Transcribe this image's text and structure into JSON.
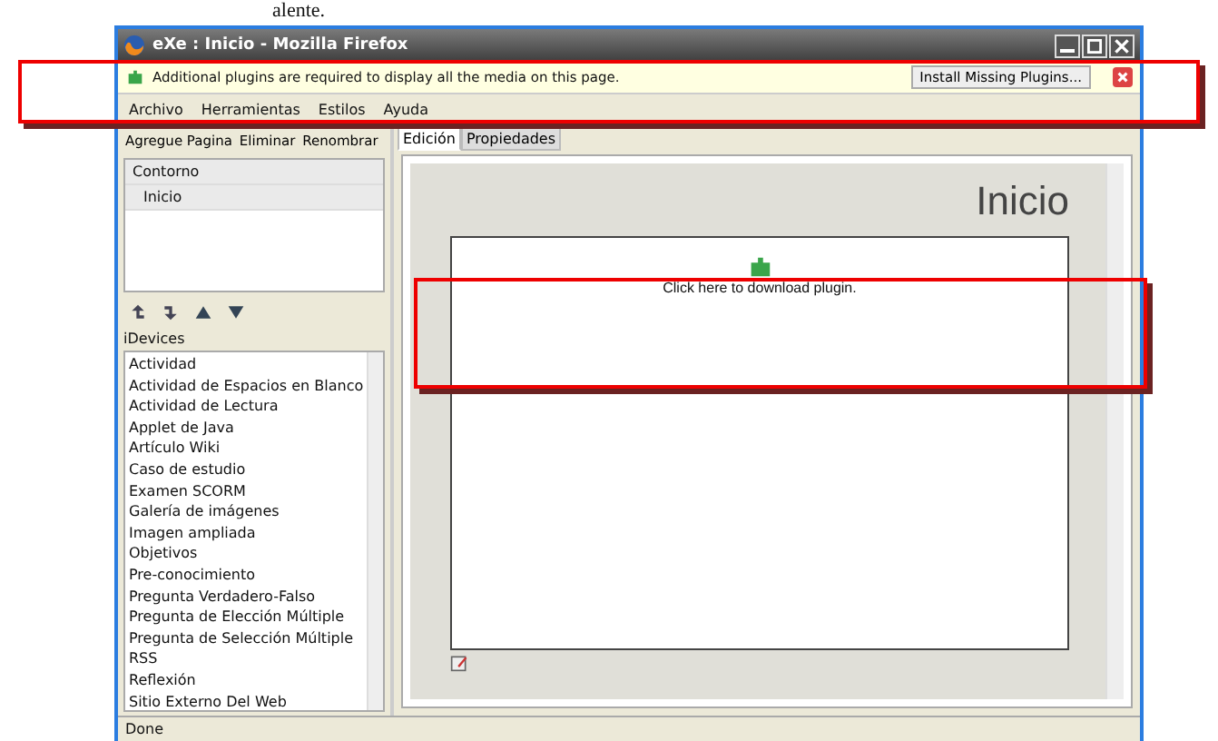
{
  "document_text": "alente.",
  "window": {
    "title": "eXe : Inicio - Mozilla Firefox"
  },
  "notification": {
    "message": "Additional plugins are required to display all the media on this page.",
    "button": "Install Missing Plugins..."
  },
  "menu": [
    "Archivo",
    "Herramientas",
    "Estilos",
    "Ayuda"
  ],
  "toolbar": [
    "Agregue Pagina",
    "Eliminar",
    "Renombrar"
  ],
  "tabs": [
    {
      "label": "Edición",
      "selected": true
    },
    {
      "label": "Propiedades",
      "selected": false
    }
  ],
  "outline": [
    {
      "label": "Contorno",
      "children": [
        {
          "label": "Inicio"
        }
      ]
    }
  ],
  "idevices": {
    "label": "iDevices",
    "items": [
      "Actividad",
      "Actividad de Espacios en Blanco",
      "Actividad de Lectura",
      "Applet de Java",
      "Artículo Wiki",
      "Caso de estudio",
      "Examen SCORM",
      "Galería de imágenes",
      "Imagen ampliada",
      "Objetivos",
      "Pre-conocimiento",
      "Pregunta Verdadero-Falso",
      "Pregunta de Elección Múltiple",
      "Pregunta de Selección Múltiple",
      "RSS",
      "Reflexión",
      "Sitio Externo Del Web"
    ]
  },
  "page": {
    "title": "Inicio",
    "plugin_text": "Click here to download plugin."
  },
  "status_bar": "Done"
}
